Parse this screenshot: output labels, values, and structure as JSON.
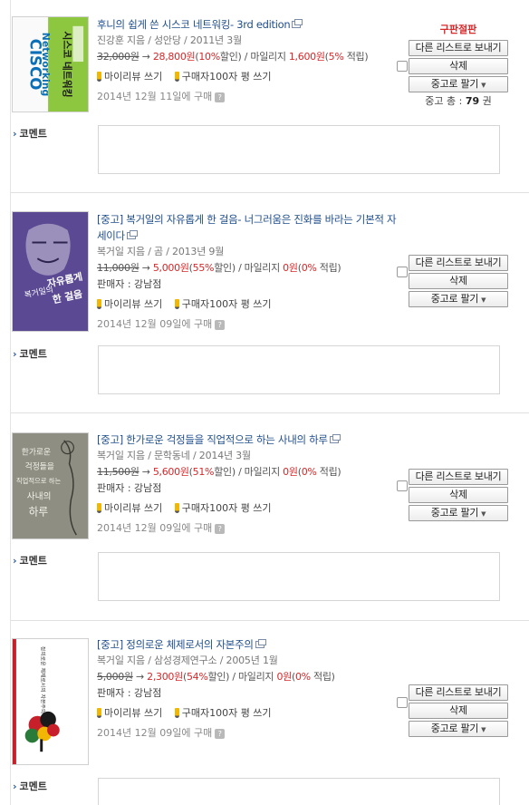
{
  "labels": {
    "send_other_list": "다른 리스트로 보내기",
    "delete": "삭제",
    "sell_used": "중고로 팔기",
    "comment": "코멘트",
    "my_review": "마이리뷰 쓰기",
    "buyer_review": "구매자100자 평 쓰기",
    "arrow": "→",
    "slash": "/",
    "won_unit": "원",
    "mileage_prefix": "/ 마일리지 ",
    "discount_suffix": "할인)",
    "earn_suffix": " 적립)",
    "open_paren": "(",
    "help": "?"
  },
  "items": [
    {
      "title": "후니의 쉽게 쓴 시스코 네트워킹- 3rd edition",
      "meta": "진강훈 지음 / 성안당 / 2011년 3월",
      "orig_price": "32,000원",
      "sale_price": "28,800원",
      "discount_pct": "10%",
      "mileage": "1,600원",
      "mileage_pct": "5%",
      "seller": "",
      "purchase_date": "2014년 12월 11일에 구매",
      "status": "구판절판",
      "used_total_label": "중고 총 : ",
      "used_total_count": "79",
      "used_total_unit": " 권",
      "cover_text": [
        "CISCO",
        "Networking",
        "시스코 네트워킹"
      ]
    },
    {
      "title": "[중고] 복거일의 자유롭게 한 걸음- 너그러움은 진화를 바라는 기본적 자세이다",
      "meta": "복거일 지음 / 곰 / 2013년 9월",
      "orig_price": "11,000원",
      "sale_price": "5,000원",
      "discount_pct": "55%",
      "mileage": "0원",
      "mileage_pct": "0%",
      "seller": "판매자 : 강남점",
      "purchase_date": "2014년 12월 09일에 구매",
      "cover_text": [
        "복거일의",
        "자유롭게",
        "한 걸음"
      ]
    },
    {
      "title": "[중고] 한가로운 걱정들을 직업적으로 하는 사내의 하루",
      "meta": "복거일 지음 / 문학동네 / 2014년 3월",
      "orig_price": "11,500원",
      "sale_price": "5,600원",
      "discount_pct": "51%",
      "mileage": "0원",
      "mileage_pct": "0%",
      "seller": "판매자 : 강남점",
      "purchase_date": "2014년 12월 09일에 구매",
      "cover_text": [
        "한가로운",
        "걱정들을",
        "직업적으로 하는",
        "사내의",
        "하루"
      ]
    },
    {
      "title": "[중고] 정의로운 체제로서의 자본주의",
      "meta": "복거일 지음 / 삼성경제연구소 / 2005년 1월",
      "orig_price": "5,000원",
      "sale_price": "2,300원",
      "discount_pct": "54%",
      "mileage": "0원",
      "mileage_pct": "0%",
      "seller": "판매자 : 강남점",
      "purchase_date": "2014년 12월 09일에 구매",
      "cover_text": [
        "정의로운 체제로서의 자본주의"
      ]
    }
  ],
  "colors": {
    "title_blue": "#1f4e8c",
    "sale_red": "#d7282a",
    "cover1_green": "#8dc63f",
    "cover2_purple": "#5b4a93",
    "cover3_gray": "#8e8e82"
  }
}
